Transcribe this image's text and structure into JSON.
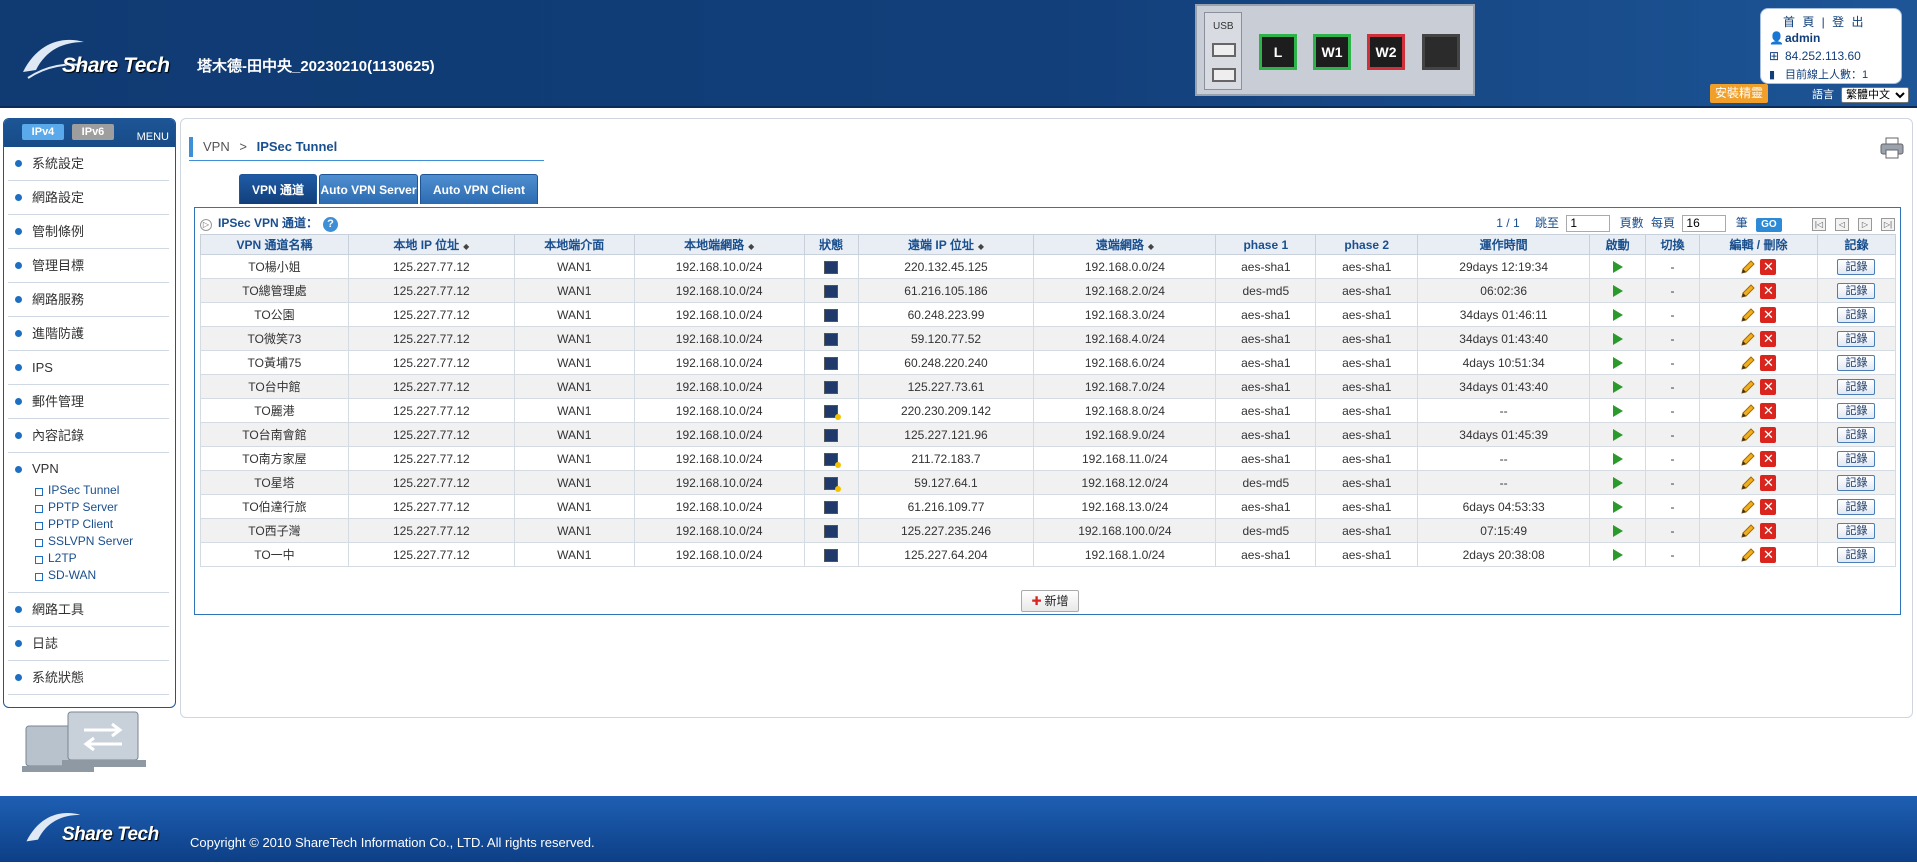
{
  "header": {
    "brand": "Share Tech",
    "device_title": "塔木德-田中央_20230210(1130625)",
    "usb_label": "USB",
    "ports": [
      "L",
      "W1",
      "W2",
      ""
    ],
    "top_links": "首 頁 | 登 出",
    "user": "admin",
    "ip": "84.252.113.60",
    "online_label": "目前線上人數：1",
    "install_label": "安裝精靈",
    "lang_label": "語言",
    "lang_value": "繁體中文"
  },
  "sidebar": {
    "ipv4": "IPv4",
    "ipv6": "IPv6",
    "menu": "MENU",
    "items": [
      {
        "label": "系統設定"
      },
      {
        "label": "網路設定"
      },
      {
        "label": "管制條例"
      },
      {
        "label": "管理目標"
      },
      {
        "label": "網路服務"
      },
      {
        "label": "進階防護"
      },
      {
        "label": "IPS"
      },
      {
        "label": "郵件管理"
      },
      {
        "label": "內容記錄"
      },
      {
        "label": "VPN"
      },
      {
        "label": "網路工具"
      },
      {
        "label": "日誌"
      },
      {
        "label": "系統狀態"
      }
    ],
    "vpn_sub": [
      "IPSec Tunnel",
      "PPTP Server",
      "PPTP Client",
      "SSLVPN Server",
      "L2TP",
      "SD-WAN"
    ]
  },
  "breadcrumb": {
    "parent": "VPN",
    "sep": ">",
    "current": "IPSec Tunnel"
  },
  "tabs": [
    "VPN 通道",
    "Auto VPN Server",
    "Auto VPN Client"
  ],
  "panel": {
    "title": "IPSec VPN 通道：",
    "help": "?",
    "page": "1 / 1",
    "jump_label": "跳至",
    "jump_value": "1",
    "page_label": "頁數",
    "per_page_label": "每頁",
    "per_page_value": "16",
    "unit": "筆",
    "go": "GO"
  },
  "table": {
    "headers": [
      "VPN 通道名稱",
      "本地 IP 位址",
      "本地端介面",
      "本地端網路",
      "狀態",
      "遠端 IP 位址",
      "遠端網路",
      "phase 1",
      "phase 2",
      "運作時間",
      "啟動",
      "切換",
      "編輯 / 刪除",
      "記錄"
    ],
    "rows": [
      [
        "TO楊小姐",
        "125.227.77.12",
        "WAN1",
        "192.168.10.0/24",
        "ok",
        "220.132.45.125",
        "192.168.0.0/24",
        "aes-sha1",
        "aes-sha1",
        "29days 12:19:34",
        "-"
      ],
      [
        "TO總管理處",
        "125.227.77.12",
        "WAN1",
        "192.168.10.0/24",
        "ok",
        "61.216.105.186",
        "192.168.2.0/24",
        "des-md5",
        "aes-sha1",
        "06:02:36",
        "-"
      ],
      [
        "TO公園",
        "125.227.77.12",
        "WAN1",
        "192.168.10.0/24",
        "ok",
        "60.248.223.99",
        "192.168.3.0/24",
        "aes-sha1",
        "aes-sha1",
        "34days 01:46:11",
        "-"
      ],
      [
        "TO微笑73",
        "125.227.77.12",
        "WAN1",
        "192.168.10.0/24",
        "ok",
        "59.120.77.52",
        "192.168.4.0/24",
        "aes-sha1",
        "aes-sha1",
        "34days 01:43:40",
        "-"
      ],
      [
        "TO黃埔75",
        "125.227.77.12",
        "WAN1",
        "192.168.10.0/24",
        "ok",
        "60.248.220.240",
        "192.168.6.0/24",
        "aes-sha1",
        "aes-sha1",
        "4days 10:51:34",
        "-"
      ],
      [
        "TO台中館",
        "125.227.77.12",
        "WAN1",
        "192.168.10.0/24",
        "ok",
        "125.227.73.61",
        "192.168.7.0/24",
        "aes-sha1",
        "aes-sha1",
        "34days 01:43:40",
        "-"
      ],
      [
        "TO麗港",
        "125.227.77.12",
        "WAN1",
        "192.168.10.0/24",
        "warn",
        "220.230.209.142",
        "192.168.8.0/24",
        "aes-sha1",
        "aes-sha1",
        "--",
        "-"
      ],
      [
        "TO台南會館",
        "125.227.77.12",
        "WAN1",
        "192.168.10.0/24",
        "ok",
        "125.227.121.96",
        "192.168.9.0/24",
        "aes-sha1",
        "aes-sha1",
        "34days 01:45:39",
        "-"
      ],
      [
        "TO南方家屋",
        "125.227.77.12",
        "WAN1",
        "192.168.10.0/24",
        "warn",
        "211.72.183.7",
        "192.168.11.0/24",
        "aes-sha1",
        "aes-sha1",
        "--",
        "-"
      ],
      [
        "TO星塔",
        "125.227.77.12",
        "WAN1",
        "192.168.10.0/24",
        "warn",
        "59.127.64.1",
        "192.168.12.0/24",
        "des-md5",
        "aes-sha1",
        "--",
        "-"
      ],
      [
        "TO伯達行旅",
        "125.227.77.12",
        "WAN1",
        "192.168.10.0/24",
        "ok",
        "61.216.109.77",
        "192.168.13.0/24",
        "aes-sha1",
        "aes-sha1",
        "6days 04:53:33",
        "-"
      ],
      [
        "TO西子灣",
        "125.227.77.12",
        "WAN1",
        "192.168.10.0/24",
        "ok",
        "125.227.235.246",
        "192.168.100.0/24",
        "des-md5",
        "aes-sha1",
        "07:15:49",
        "-"
      ],
      [
        "TO一中",
        "125.227.77.12",
        "WAN1",
        "192.168.10.0/24",
        "ok",
        "125.227.64.204",
        "192.168.1.0/24",
        "aes-sha1",
        "aes-sha1",
        "2days 20:38:08",
        "-"
      ]
    ],
    "log_label": "記錄"
  },
  "add_label": "新增",
  "footer": {
    "copyright": "Copyright © 2010 ShareTech Information Co., LTD. All rights reserved."
  },
  "colors": {
    "header": "#123f7a",
    "accent": "#3f8fd6",
    "install": "#f0a02a",
    "delete": "#d9251d",
    "play": "#2a9a2a"
  }
}
